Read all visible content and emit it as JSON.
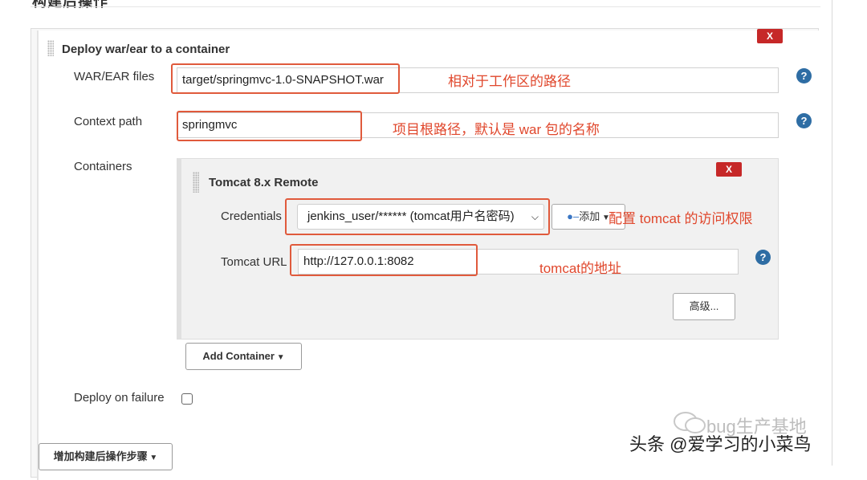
{
  "page": {
    "top_header": "构建后操作"
  },
  "deploy_section": {
    "title": "Deploy war/ear to a container",
    "delete_label": "X",
    "war_files": {
      "label": "WAR/EAR files",
      "value": "target/springmvc-1.0-SNAPSHOT.war",
      "annotation": "相对于工作区的路径"
    },
    "context_path": {
      "label": "Context path",
      "value": "springmvc",
      "annotation": "项目根路径，默认是 war 包的名称"
    },
    "containers_label": "Containers",
    "help_glyph": "?",
    "tomcat": {
      "title": "Tomcat 8.x Remote",
      "delete_label": "X",
      "credentials": {
        "label": "Credentials",
        "selected": "jenkins_user/****** (tomcat用户名密码)",
        "add_label": "添加",
        "annotation": "配置 tomcat 的访问权限"
      },
      "url": {
        "label": "Tomcat URL",
        "value": "http://127.0.0.1:8082",
        "annotation": "tomcat的地址"
      },
      "advanced_label": "高级..."
    },
    "add_container_label": "Add Container",
    "deploy_on_failure_label": "Deploy on failure",
    "deploy_on_failure_checked": false
  },
  "add_post_build_label": "增加构建后操作步骤",
  "watermark": {
    "line1": "bug生产基地",
    "line2": "头条 @爱学习的小菜鸟"
  }
}
